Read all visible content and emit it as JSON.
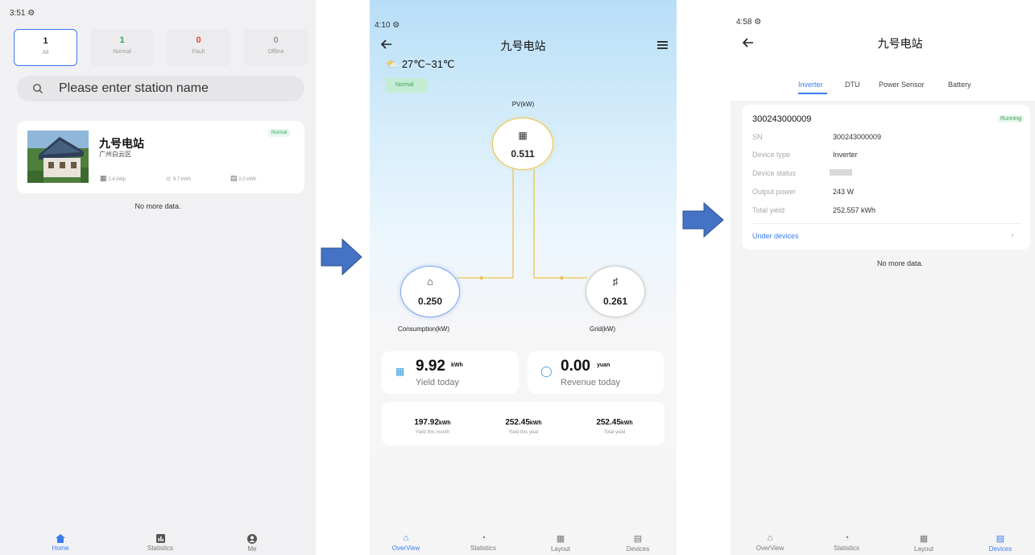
{
  "screen1": {
    "status_time": "3:51",
    "tabs": [
      {
        "count": "1",
        "label": "All",
        "color": "#222222"
      },
      {
        "count": "1",
        "label": "Normal",
        "color": "#3aa35c"
      },
      {
        "count": "0",
        "label": "Fault",
        "color": "#e8452f"
      },
      {
        "count": "0",
        "label": "Offline",
        "color": "#999999"
      }
    ],
    "search_placeholder": "Please enter station name",
    "station": {
      "name": "九号电站",
      "location": "广州白云区",
      "status": "Normal",
      "capacity": "2.4 kWp",
      "yield": "9.7 kWh",
      "storage": "2.0 kWh"
    },
    "no_more": "No more data.",
    "nav": [
      "Home",
      "Statistics",
      "Me"
    ]
  },
  "screen2": {
    "status_time": "4:10",
    "title": "九号电站",
    "weather": "27℃~31℃",
    "status": "Normal",
    "pv_label": "PV(kW)",
    "pv_value": "0.511",
    "consumption_value": "0.250",
    "consumption_label": "Consumption(kW)",
    "grid_value": "0.261",
    "grid_label": "Grid(kW)",
    "yield_today": {
      "value": "9.92",
      "unit": "kWh",
      "label": "Yield today"
    },
    "revenue_today": {
      "value": "0.00",
      "unit": "yuan",
      "label": "Revenue today"
    },
    "totals": [
      {
        "value": "197.92",
        "unit": "kWh",
        "label": "Yield this month"
      },
      {
        "value": "252.45",
        "unit": "kWh",
        "label": "Yield this year"
      },
      {
        "value": "252.45",
        "unit": "kWh",
        "label": "Total yield"
      }
    ],
    "nav": [
      "OverView",
      "Statistics",
      "Layout",
      "Devices"
    ]
  },
  "screen3": {
    "status_time": "4:58",
    "title": "九号电站",
    "tabs": [
      "Inverter",
      "DTU",
      "Power Sensor",
      "Battery"
    ],
    "device": {
      "id": "300243000009",
      "state": "Running",
      "rows": [
        {
          "label": "SN",
          "value": "300243000009"
        },
        {
          "label": "Device type",
          "value": "Inverter"
        },
        {
          "label": "Device status",
          "value": ""
        },
        {
          "label": "Output power",
          "value": "243 W"
        },
        {
          "label": "Total yield",
          "value": "252.557 kWh"
        }
      ],
      "under_devices": "Under devices"
    },
    "no_more": "No more data.",
    "nav": [
      "OverView",
      "Statistics",
      "Layout",
      "Devices"
    ]
  },
  "colors": {
    "accent": "#3a7cf0",
    "arrow": "#4472c4",
    "flow": "#f0c24a"
  }
}
